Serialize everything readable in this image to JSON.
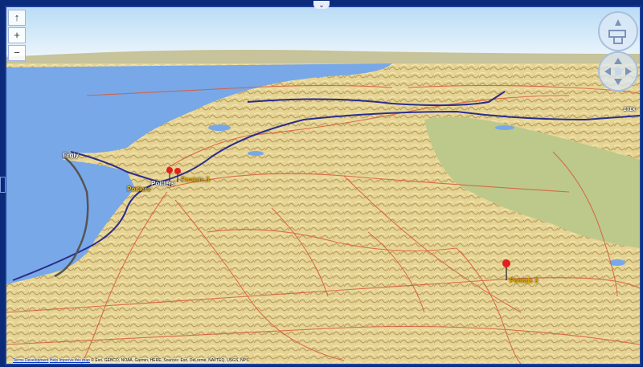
{
  "controls": {
    "compass_north": "↑",
    "zoom_in": "+",
    "zoom_out": "−",
    "collapse_top": "⌄"
  },
  "labels": {
    "top_right": "ɪᴛɪx",
    "city_main": "Poitiers",
    "city_small": "Poitiers",
    "left_town": "Ergiy"
  },
  "pins": [
    {
      "label": "Pontais 3"
    },
    {
      "label": "Pontais 3"
    }
  ],
  "attribution": {
    "link1": "Terms Development",
    "link2": "Help Improve this map",
    "text": "© Esri, GEBCO, NOAA, Garmin, HERE, Sources: Esri, DeLorme, NAVTEQ, USGS, NPS"
  },
  "colors": {
    "water": "#78a8e8",
    "land": "#e8d9a0",
    "plain": "#bfc98a",
    "roads": "#d95a3a",
    "highways": "#2b2d8a",
    "sky": "#cfe6f7",
    "pin": "#e02020"
  }
}
